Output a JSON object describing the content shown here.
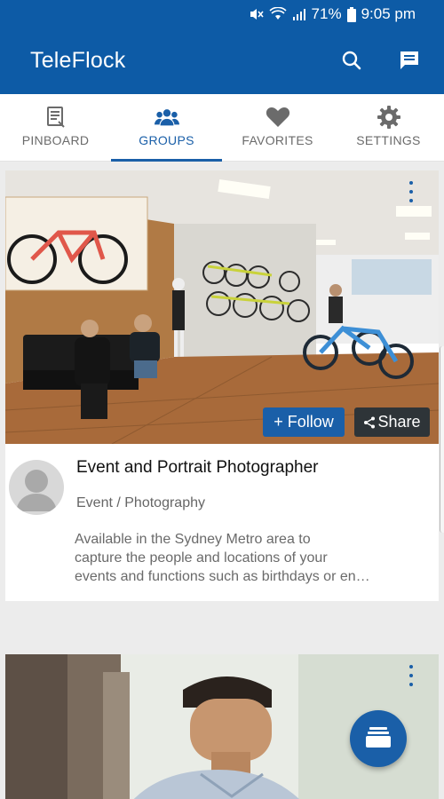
{
  "status_bar": {
    "battery": "71%",
    "time": "9:05 pm"
  },
  "app_bar": {
    "title": "TeleFlock",
    "icons": [
      "search-icon",
      "chat-icon"
    ]
  },
  "tabs": [
    {
      "label": "PINBOARD",
      "icon": "pinboard-icon",
      "active": false
    },
    {
      "label": "GROUPS",
      "icon": "groups-icon",
      "active": true
    },
    {
      "label": "FAVORITES",
      "icon": "heart-icon",
      "active": false
    },
    {
      "label": "SETTINGS",
      "icon": "gear-icon",
      "active": false
    }
  ],
  "cards": [
    {
      "title": "Event and Portrait Photographer",
      "category": "Event / Photography",
      "description_lines": [
        "Available in the Sydney Metro area to",
        "capture the people and locations of your",
        "events and functions such as birthdays or en…"
      ],
      "follow_label": "+ Follow",
      "share_label": "Share"
    }
  ],
  "colors": {
    "primary": "#0d5ba6",
    "accent": "#1a5fa8",
    "share_bg": "#2e3438"
  }
}
